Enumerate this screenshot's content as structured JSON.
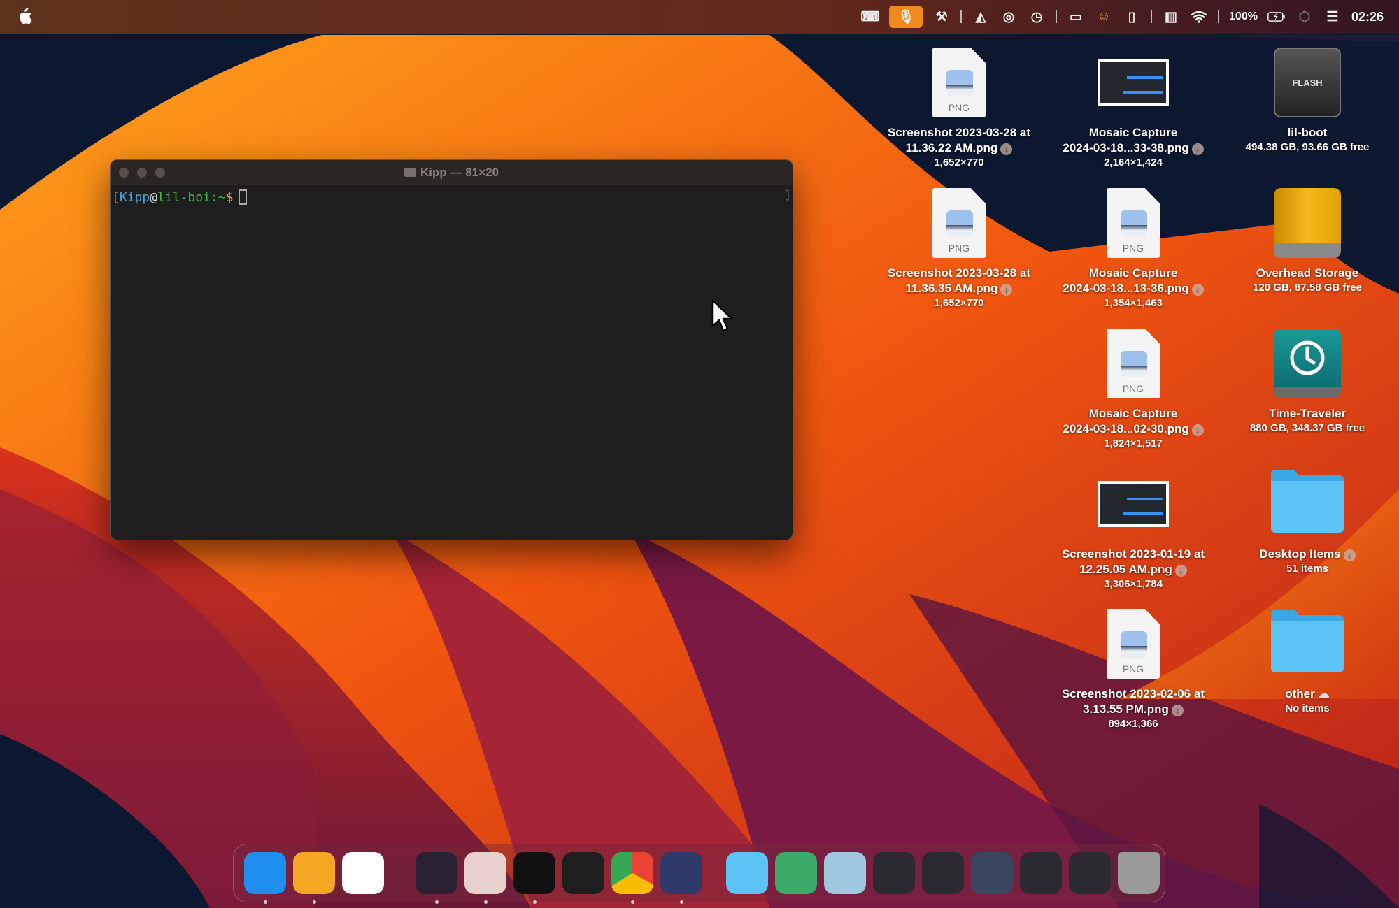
{
  "menubar": {
    "battery": "100%",
    "clock": "02:26",
    "icons": [
      "keyboard-icon",
      "microphone-icon",
      "hammer-icon",
      "drive-icon",
      "steering-wheel-icon",
      "time-machine-icon",
      "bed-icon",
      "face-icon",
      "phone-icon",
      "columns-icon",
      "wifi-icon",
      "battery-icon",
      "hexagon-icon",
      "control-center-icon"
    ]
  },
  "terminal": {
    "title": "Kipp — 81×20",
    "user": "Kipp",
    "at": "@",
    "host": "lil-boi",
    "path": ":~",
    "symbol": "$",
    "open_bracket": "["
  },
  "desktop": [
    {
      "name": "Screenshot 2023-03-28 at",
      "name2": "11.36.22 AM.png",
      "sub": "1,652×770",
      "kind": "png",
      "dl": true
    },
    {
      "name": "Mosaic Capture",
      "name2": "2024-03-18...33-38.png",
      "sub": "2,164×1,424",
      "kind": "thumb",
      "dl": true
    },
    {
      "name": "lil-boot",
      "name2": "",
      "sub": "494.38 GB, 93.66 GB free",
      "kind": "flash",
      "dl": false,
      "label": "FLASH"
    },
    {
      "name": "Screenshot 2023-03-28 at",
      "name2": "11.36.35 AM.png",
      "sub": "1,652×770",
      "kind": "png",
      "dl": true
    },
    {
      "name": "Mosaic Capture",
      "name2": "2024-03-18...13-36.png",
      "sub": "1,354×1,463",
      "kind": "png",
      "dl": true
    },
    {
      "name": "Overhead Storage",
      "name2": "",
      "sub": "120 GB, 87.58 GB free",
      "kind": "drive",
      "dl": false
    },
    {
      "name": "Mosaic Capture",
      "name2": "2024-03-18...02-30.png",
      "sub": "1,824×1,517",
      "kind": "png",
      "dl": true
    },
    {
      "name": "Time-Traveler",
      "name2": "",
      "sub": "880 GB, 348.37 GB free",
      "kind": "timemachine",
      "dl": false
    },
    {
      "name": "Screenshot 2023-01-19 at",
      "name2": "12.25.05 AM.png",
      "sub": "3,306×1,784",
      "kind": "thumb",
      "dl": true
    },
    {
      "name": "Desktop Items",
      "name2": "",
      "sub": "51 items",
      "kind": "folder",
      "dl": true
    },
    {
      "name": "Screenshot 2023-02-06 at",
      "name2": "3.13.55 PM.png",
      "sub": "894×1,366",
      "kind": "png",
      "dl": true
    },
    {
      "name": "other",
      "name2": "",
      "sub": "No items",
      "kind": "folder",
      "cloud": true
    }
  ],
  "png_label": "PNG",
  "dock": [
    {
      "name": "finder",
      "color": "#1e8ff0",
      "running": true
    },
    {
      "name": "notes-app",
      "color": "#f5a623",
      "running": true
    },
    {
      "name": "safari-like-app",
      "color": "#ffffff",
      "running": false
    },
    {
      "name": "obsidian",
      "color": "#2a2233",
      "running": true
    },
    {
      "name": "craft-app",
      "color": "#e8d0cc",
      "running": true
    },
    {
      "name": "terminal",
      "color": "#111111",
      "running": true
    },
    {
      "name": "activity-chart",
      "color": "#1e1e1e",
      "running": false
    },
    {
      "name": "chrome",
      "color": "#ffffff",
      "running": true
    },
    {
      "name": "shortcuts",
      "color": "#2f3a6a",
      "running": true
    },
    {
      "name": "applications-folder",
      "color": "#5cc4f5",
      "running": false,
      "sep": true
    },
    {
      "name": "downloads-folder",
      "color": "#3cab6a",
      "running": false
    },
    {
      "name": "screenshots-folder",
      "color": "#9fc8e0",
      "running": false
    },
    {
      "name": "window-chrome",
      "color": "#2a2a30",
      "running": false
    },
    {
      "name": "window-shortcuts",
      "color": "#2a2a30",
      "running": false
    },
    {
      "name": "window-obsidian",
      "color": "#3a4660",
      "running": false
    },
    {
      "name": "window-finder",
      "color": "#2a2a30",
      "running": false
    },
    {
      "name": "window-shortcuts-2",
      "color": "#2a2a30",
      "running": false
    },
    {
      "name": "trash",
      "color": "#9a9a9a",
      "running": false
    }
  ]
}
